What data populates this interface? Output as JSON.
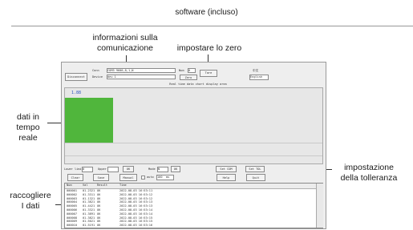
{
  "page_title": "software (incluso)",
  "annotations": {
    "communication_info": [
      "informazioni sulla",
      "comunicazione"
    ],
    "set_zero": "impostare lo zero",
    "realtime_data": [
      "dati in",
      "tempo",
      "reale"
    ],
    "tolerance_setting": [
      "impostazione",
      "della tolleranza"
    ],
    "collect_data": [
      "raccogliere",
      "I dati"
    ]
  },
  "app": {
    "top_left_button": "Disconnect",
    "comm_labels": [
      "Conn",
      "Device"
    ],
    "comm_values": [
      "COM3 9600,8,1,N",
      "dev 1"
    ],
    "zero_label": "Num",
    "zero_button": "Zero",
    "zero_value": "0",
    "tare_button": "Tare",
    "lang_label": "中文",
    "lang_select": "English",
    "plot_caption": "Real time data chart display area",
    "plot_value": "1.88",
    "limits": {
      "lower_label": "Lower limit",
      "lower_value": "0",
      "upper_label": "Upper",
      "upper_value": "",
      "ok_button": "OK",
      "mode_label": "Mode",
      "mode_value": "N",
      "mode_ok": "OK",
      "set_com_button": "Set COM",
      "set_tol_button": "Set TOL"
    },
    "actions": {
      "clear": "Clear",
      "save": "Save",
      "manual": "Manual",
      "auto": "auto",
      "interval": "100",
      "unit": "ms",
      "help": "Help",
      "quit": "Quit"
    },
    "table": {
      "columns": [
        "Num",
        "Val",
        "Result",
        "Time"
      ],
      "rows": [
        [
          "000001",
          "01.2321",
          "OK",
          "2022-08-03  16:53:11"
        ],
        [
          "000002",
          "01.3311",
          "OK",
          "2022-08-03  16:53:12"
        ],
        [
          "000003",
          "01.1321",
          "OK",
          "2022-08-03  16:53:12"
        ],
        [
          "000004",
          "01.3821",
          "OK",
          "2022-08-03  16:53:13"
        ],
        [
          "000005",
          "01.4421",
          "OK",
          "2022-08-03  16:53:13"
        ],
        [
          "000006",
          "01.3321",
          "OK",
          "2022-08-03  16:53:14"
        ],
        [
          "000007",
          "01.3891",
          "OK",
          "2022-08-03  16:53:14"
        ],
        [
          "000008",
          "01.3821",
          "OK",
          "2022-08-03  16:53:15"
        ],
        [
          "000009",
          "01.5021",
          "OK",
          "2022-08-03  16:53:15"
        ],
        [
          "000010",
          "01.5191",
          "OK",
          "2022-08-03  16:53:16"
        ]
      ]
    }
  },
  "colors": {
    "realtime_bar": "#50b63c",
    "window_bg": "#eeeeee"
  }
}
